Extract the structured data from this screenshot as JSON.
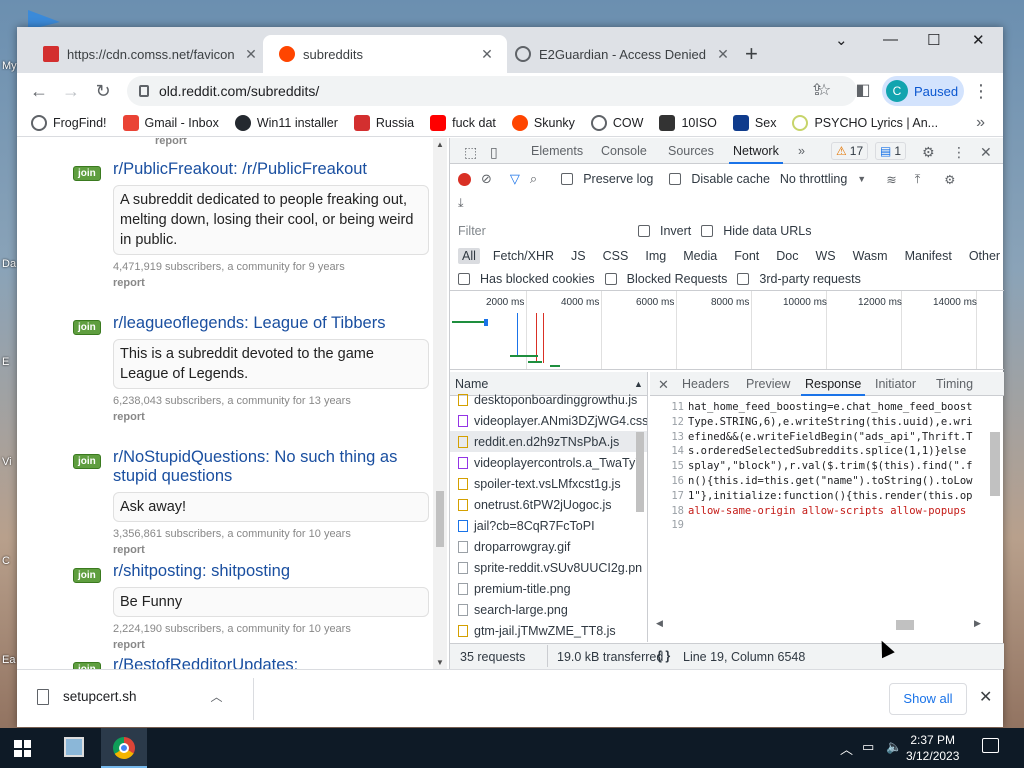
{
  "desktop": {
    "labels": [
      "My",
      "Da",
      "E",
      "Vi",
      "C",
      "Ea"
    ]
  },
  "tabs": [
    {
      "title": "https://cdn.comss.net/favicon.sv",
      "favicon_color": "#d32f2f",
      "active": false
    },
    {
      "title": "subreddits",
      "favicon_color": "#ff4500",
      "active": true
    },
    {
      "title": "E2Guardian - Access Denied",
      "favicon_color": "#5f6368",
      "active": false
    }
  ],
  "window_controls": {
    "tab_search": "⌄",
    "minimize": "—",
    "maximize": "☐",
    "close": "✕"
  },
  "toolbar": {
    "url": "old.reddit.com/subreddits/",
    "profile_initial": "C",
    "profile_status": "Paused"
  },
  "bookmarks": [
    {
      "label": "FrogFind!",
      "color": "#5f6368"
    },
    {
      "label": "Gmail - Inbox",
      "color": "#ea4335"
    },
    {
      "label": "Win11 installer",
      "color": "#24292f"
    },
    {
      "label": "Russia",
      "color": "#d32f2f"
    },
    {
      "label": "fuck dat",
      "color": "#ff0000"
    },
    {
      "label": "Skunky",
      "color": "#ff4500"
    },
    {
      "label": "COW",
      "color": "#5f6368"
    },
    {
      "label": "10ISO",
      "color": "#333333"
    },
    {
      "label": "Sex",
      "color": "#0f3b8c"
    },
    {
      "label": "PSYCHO Lyrics | An...",
      "color": "#c7d46a"
    }
  ],
  "page": {
    "top_report": "report",
    "subreddits": [
      {
        "join": "join",
        "title": "r/PublicFreakout: /r/PublicFreakout",
        "desc": "A subreddit dedicated to people freaking out, melting down, losing their cool, or being weird in public.",
        "meta": "4,471,919 subscribers, a community for 9 years",
        "report": "report"
      },
      {
        "join": "join",
        "title": "r/leagueoflegends: League of Tibbers",
        "desc": "This is a subreddit devoted to the game League of Legends.",
        "meta": "6,238,043 subscribers, a community for 13 years",
        "report": "report"
      },
      {
        "join": "join",
        "title": "r/NoStupidQuestions: No such thing as stupid questions",
        "desc": "Ask away!",
        "meta": "3,356,861 subscribers, a community for 10 years",
        "report": "report"
      },
      {
        "join": "join",
        "title": "r/shitposting: shitposting",
        "desc": "Be Funny",
        "meta": "2,224,190 subscribers, a community for 10 years",
        "report": "report"
      },
      {
        "join": "join",
        "title": "r/BestofRedditorUpdates:",
        "desc": "",
        "meta": "",
        "report": ""
      }
    ]
  },
  "devtools": {
    "tabs": [
      "Elements",
      "Console",
      "Sources",
      "Network"
    ],
    "active_tab": "Network",
    "more": "»",
    "warnings": "17",
    "messages": "1",
    "preserve_log": "Preserve log",
    "disable_cache": "Disable cache",
    "throttling": "No throttling",
    "filter_placeholder": "Filter",
    "invert": "Invert",
    "hide_data_urls": "Hide data URLs",
    "types": [
      "All",
      "Fetch/XHR",
      "JS",
      "CSS",
      "Img",
      "Media",
      "Font",
      "Doc",
      "WS",
      "Wasm",
      "Manifest",
      "Other"
    ],
    "blocked_cookies": "Has blocked cookies",
    "blocked_requests": "Blocked Requests",
    "third_party": "3rd-party requests",
    "timeline_ticks": [
      "2000 ms",
      "4000 ms",
      "6000 ms",
      "8000 ms",
      "10000 ms",
      "12000 ms",
      "14000 ms"
    ],
    "name_header": "Name",
    "requests": [
      {
        "name": "desktoponboardinggrowthu.js",
        "color": "#d4a000"
      },
      {
        "name": "videoplayer.ANmi3DZjWG4.css",
        "color": "#9334e6"
      },
      {
        "name": "reddit.en.d2h9zTNsPbA.js",
        "color": "#d4a000",
        "selected": true
      },
      {
        "name": "videoplayercontrols.a_TwaTy7",
        "color": "#9334e6"
      },
      {
        "name": "spoiler-text.vsLMfxcst1g.js",
        "color": "#d4a000"
      },
      {
        "name": "onetrust.6tPW2jUogoc.js",
        "color": "#d4a000"
      },
      {
        "name": "jail?cb=8CqR7FcToPI",
        "color": "#1a73e8"
      },
      {
        "name": "droparrowgray.gif",
        "color": "#9aa0a6"
      },
      {
        "name": "sprite-reddit.vSUv8UUCI2g.pn",
        "color": "#9aa0a6"
      },
      {
        "name": "premium-title.png",
        "color": "#9aa0a6"
      },
      {
        "name": "search-large.png",
        "color": "#9aa0a6"
      },
      {
        "name": "gtm-jail.jTMwZME_TT8.js",
        "color": "#d4a000"
      }
    ],
    "detail_tabs": [
      "Headers",
      "Preview",
      "Response",
      "Initiator",
      "Timing"
    ],
    "active_detail_tab": "Response",
    "code_lines": [
      {
        "n": "11",
        "t": "hat_home_feed_boosting=e.chat_home_feed_boost"
      },
      {
        "n": "12",
        "t": "Type.STRING,6),e.writeString(this.uuid),e.wri"
      },
      {
        "n": "13",
        "t": "efined&&(e.writeFieldBegin(\"ads_api\",Thrift.T"
      },
      {
        "n": "14",
        "t": "s.orderedSelectedSubreddits.splice(1,1)}else"
      },
      {
        "n": "15",
        "t": "splay\",\"block\"),r.val($.trim($(this).find(\".f"
      },
      {
        "n": "16",
        "t": "n(){this.id=this.get(\"name\").toString().toLow"
      },
      {
        "n": "17",
        "t": "1\"},initialize:function(){this.render(this.op"
      },
      {
        "n": "18",
        "t": "allow-same-origin allow-scripts allow-popups"
      },
      {
        "n": "19",
        "t": ""
      }
    ],
    "status_requests": "35 requests",
    "status_transferred": "19.0 kB transferred",
    "cursor_pos": "Line 19, Column 6548"
  },
  "download": {
    "file": "setupcert.sh",
    "show_all": "Show all"
  },
  "taskbar": {
    "time": "2:37 PM",
    "date": "3/12/2023"
  }
}
